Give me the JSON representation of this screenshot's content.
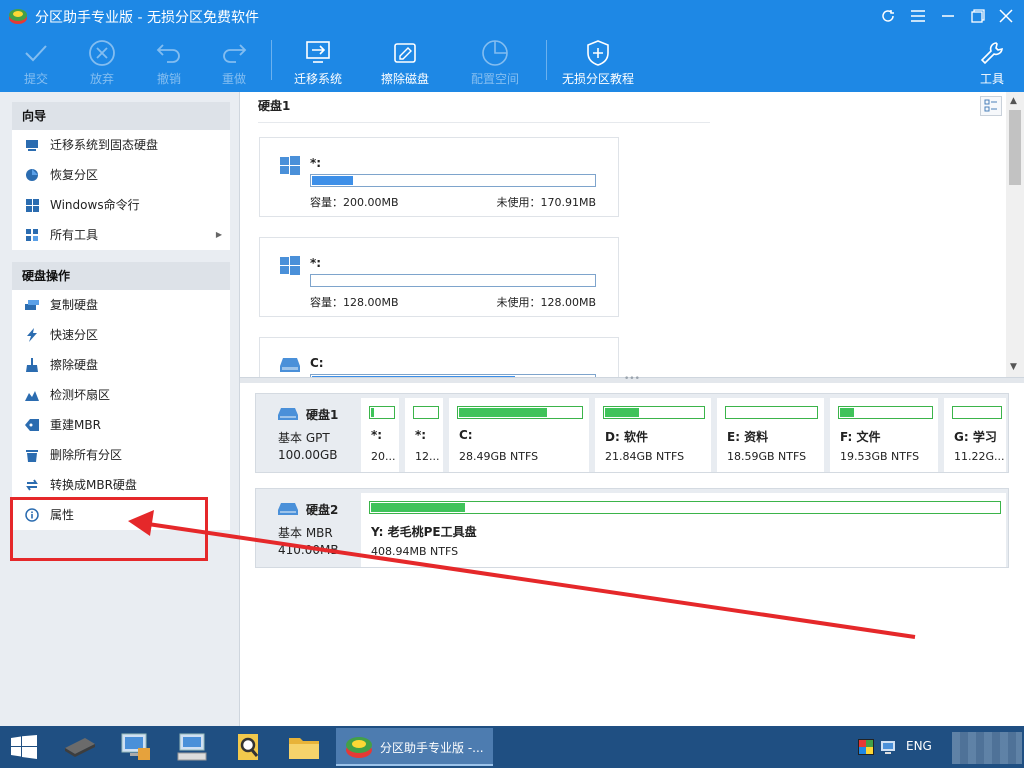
{
  "window": {
    "title": "分区助手专业版 - 无损分区免费软件",
    "controls": [
      "refresh-icon",
      "menu-icon",
      "minimize-icon",
      "maximize-icon",
      "close-icon"
    ]
  },
  "toolbar": {
    "buttons": [
      {
        "label": "提交",
        "icon": "check-icon",
        "enabled": false
      },
      {
        "label": "放弃",
        "icon": "discard-icon",
        "enabled": false
      },
      {
        "label": "撤销",
        "icon": "undo-icon",
        "enabled": false
      },
      {
        "label": "重做",
        "icon": "redo-icon",
        "enabled": false
      },
      {
        "label": "迁移系统",
        "icon": "migrate-os-icon",
        "enabled": true
      },
      {
        "label": "擦除磁盘",
        "icon": "wipe-disk-icon",
        "enabled": true
      },
      {
        "label": "配置空间",
        "icon": "allocate-space-icon",
        "enabled": false
      },
      {
        "label": "无损分区教程",
        "icon": "shield-icon",
        "enabled": true
      },
      {
        "label": "工具",
        "icon": "wrench-icon",
        "enabled": true
      }
    ]
  },
  "sidebar": {
    "wizard": {
      "title": "向导",
      "items": [
        {
          "label": "迁移系统到固态硬盘",
          "icon": "migrate-ssd-icon"
        },
        {
          "label": "恢复分区",
          "icon": "recover-partition-icon"
        },
        {
          "label": "Windows命令行",
          "icon": "windows-icon"
        },
        {
          "label": "所有工具",
          "icon": "all-tools-icon"
        }
      ]
    },
    "disk_ops": {
      "title": "硬盘操作",
      "items": [
        {
          "label": "复制硬盘",
          "icon": "copy-disk-icon"
        },
        {
          "label": "快速分区",
          "icon": "lightning-icon"
        },
        {
          "label": "擦除硬盘",
          "icon": "broom-icon"
        },
        {
          "label": "检测坏扇区",
          "icon": "bad-sector-icon"
        },
        {
          "label": "重建MBR",
          "icon": "tag-icon"
        },
        {
          "label": "删除所有分区",
          "icon": "trash-icon"
        },
        {
          "label": "转换成MBR硬盘",
          "icon": "convert-icon"
        },
        {
          "label": "属性",
          "icon": "info-icon"
        }
      ]
    }
  },
  "upper": {
    "header": "硬盘1",
    "partitions": [
      {
        "name": "*:",
        "capacity": "容量：200.00MB",
        "free": "未使用：170.91MB",
        "used_fraction": 0.146
      },
      {
        "name": "*:",
        "capacity": "容量：128.00MB",
        "free": "未使用：128.00MB",
        "used_fraction": 0.0
      },
      {
        "name": "C:",
        "capacity": "",
        "free": "",
        "used_fraction": 0.72
      }
    ]
  },
  "disks": [
    {
      "name": "硬盘1",
      "type": "基本 GPT",
      "size": "100.00GB",
      "partitions": [
        {
          "name": "*:",
          "info": "20...",
          "used_fraction": 0.15
        },
        {
          "name": "*:",
          "info": "12...",
          "used_fraction": 0.0
        },
        {
          "name": "C:",
          "info": "28.49GB NTFS",
          "used_fraction": 0.72
        },
        {
          "name": "D: 软件",
          "info": "21.84GB NTFS",
          "used_fraction": 0.35
        },
        {
          "name": "E: 资料",
          "info": "18.59GB NTFS",
          "used_fraction": 0.0
        },
        {
          "name": "F: 文件",
          "info": "19.53GB NTFS",
          "used_fraction": 0.15
        },
        {
          "name": "G: 学习",
          "info": "11.22G...",
          "used_fraction": 0.0
        }
      ]
    },
    {
      "name": "硬盘2",
      "type": "基本 MBR",
      "size": "410.00MB",
      "partitions": [
        {
          "name": "Y: 老毛桃PE工具盘",
          "info": "408.94MB NTFS",
          "used_fraction": 0.15
        }
      ]
    }
  ],
  "taskbar": {
    "active_window": "分区助手专业版 -...",
    "language": "ENG",
    "apps": [
      "windows-start-icon",
      "memory-chip-icon",
      "computer-network-icon",
      "keyboard-computer-icon",
      "magnifier-icon",
      "folder-icon",
      "partition-assistant-icon"
    ]
  },
  "colors": {
    "accent": "#1e88e5",
    "used_bar": "#3d8fe8",
    "partition_used": "#3fc35a",
    "annotation": "#e5282a",
    "taskbar": "#1f4f82"
  }
}
